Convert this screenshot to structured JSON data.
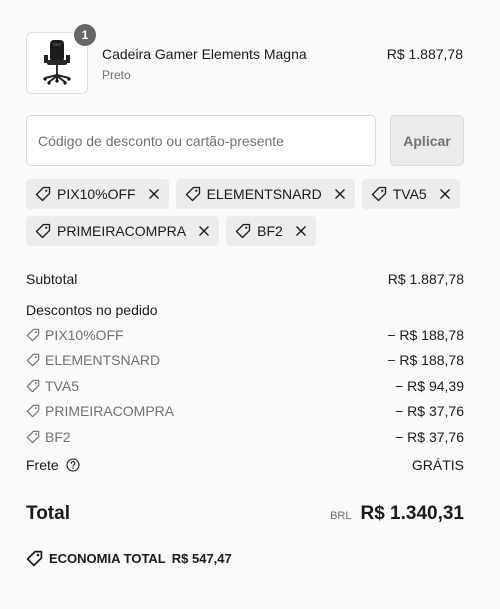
{
  "product": {
    "name": "Cadeira Gamer Elements Magna",
    "variant": "Preto",
    "price": "R$ 1.887,78",
    "quantity": "1"
  },
  "discount": {
    "placeholder": "Código de desconto ou cartão-presente",
    "apply_label": "Aplicar"
  },
  "applied_codes": [
    "PIX10%OFF",
    "ELEMENTSNARD",
    "TVA5",
    "PRIMEIRACOMPRA",
    "BF2"
  ],
  "summary": {
    "subtotal_label": "Subtotal",
    "subtotal_value": "R$ 1.887,78",
    "discounts_title": "Descontos no pedido",
    "discounts": [
      {
        "code": "PIX10%OFF",
        "amount": "− R$ 188,78"
      },
      {
        "code": "ELEMENTSNARD",
        "amount": "− R$ 188,78"
      },
      {
        "code": "TVA5",
        "amount": "− R$ 94,39"
      },
      {
        "code": "PRIMEIRACOMPRA",
        "amount": "− R$ 37,76"
      },
      {
        "code": "BF2",
        "amount": "− R$ 37,76"
      }
    ],
    "shipping_label": "Frete",
    "shipping_value": "GRÁTIS"
  },
  "total": {
    "label": "Total",
    "currency": "BRL",
    "value": "R$ 1.340,31"
  },
  "savings": {
    "label": "ECONOMIA TOTAL",
    "value": "R$ 547,47"
  },
  "icons": {
    "tag": "tag-icon",
    "remove": "close-icon",
    "help": "question-circle-icon"
  }
}
